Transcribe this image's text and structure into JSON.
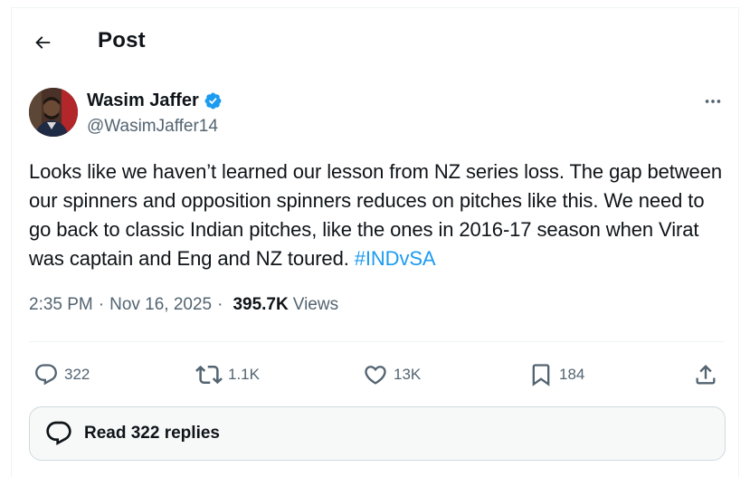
{
  "header": {
    "title": "Post",
    "back_icon": "arrow-left-icon"
  },
  "author": {
    "display_name": "Wasim Jaffer",
    "handle": "@WasimJaffer14",
    "verified_color": "#1d9bf0"
  },
  "tweet": {
    "text": "Looks like we haven’t learned our lesson from NZ series loss. The gap between our spinners and opposition spinners reduces on pitches like this. We need to go back to classic Indian pitches, like the ones in 2016-17 season when Virat was captain and Eng and NZ toured. ",
    "hashtag": "#INDvSA"
  },
  "meta": {
    "time": "2:35 PM",
    "date": "Nov 16, 2025",
    "separator": "·",
    "views_count": "395.7K",
    "views_label": "Views"
  },
  "actions": {
    "replies": "322",
    "reposts": "1.1K",
    "likes": "13K",
    "bookmarks": "184"
  },
  "read_replies": {
    "label": "Read 322 replies"
  },
  "colors": {
    "accent": "#1d9bf0",
    "text_primary": "#0f1419",
    "text_secondary": "#536471",
    "border": "#cfd9de"
  }
}
